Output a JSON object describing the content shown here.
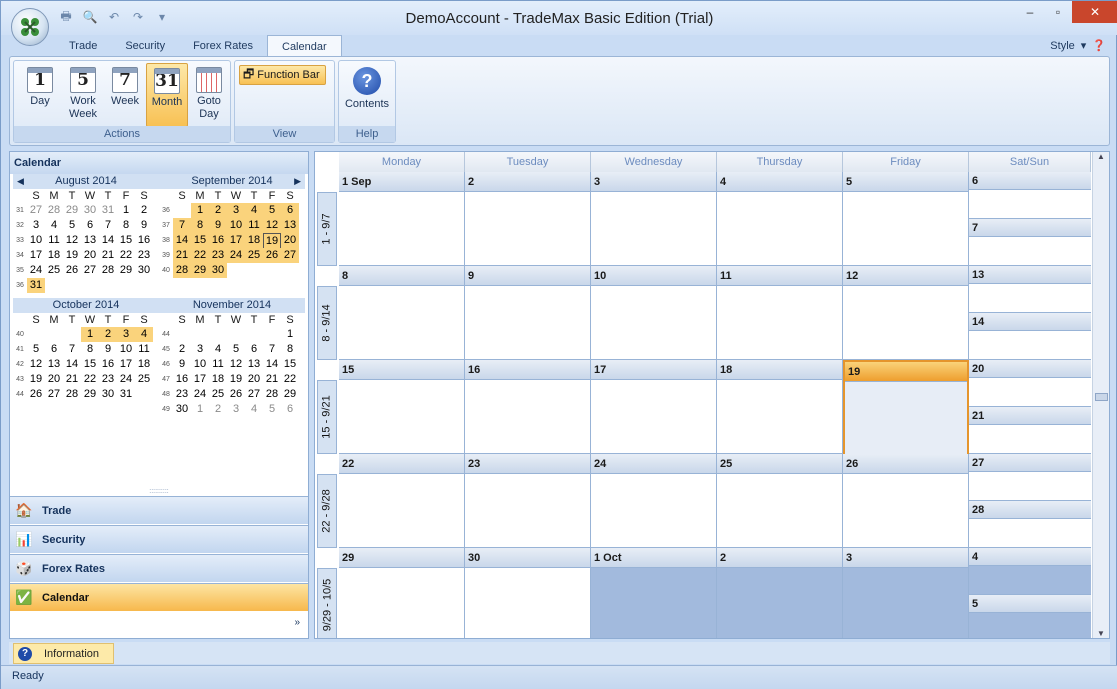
{
  "window": {
    "title": "DemoAccount - TradeMax Basic Edition (Trial)"
  },
  "qat": {
    "icons": [
      "printer-icon",
      "print-preview-icon",
      "undo-icon",
      "redo-icon",
      "customize-icon"
    ]
  },
  "tabs": [
    {
      "label": "Trade"
    },
    {
      "label": "Security"
    },
    {
      "label": "Forex Rates"
    },
    {
      "label": "Calendar"
    }
  ],
  "style_menu": {
    "label": "Style"
  },
  "ribbon": {
    "actions": {
      "label": "Actions",
      "buttons": [
        {
          "glyph": "1",
          "label_top": "Day",
          "label_bottom": ""
        },
        {
          "glyph": "5",
          "label_top": "Work",
          "label_bottom": "Week"
        },
        {
          "glyph": "7",
          "label_top": "Week",
          "label_bottom": ""
        },
        {
          "glyph": "31",
          "label_top": "Month",
          "label_bottom": ""
        },
        {
          "glyph": "",
          "label_top": "Goto",
          "label_bottom": "Day"
        }
      ]
    },
    "view": {
      "label": "View",
      "function_bar": "Function Bar"
    },
    "help": {
      "label": "Help",
      "contents": "Contents"
    }
  },
  "left_pane": {
    "title": "Calendar",
    "dow": [
      "S",
      "M",
      "T",
      "W",
      "T",
      "F",
      "S"
    ],
    "months": [
      {
        "name": "August 2014",
        "weeks": [
          {
            "wk": "31",
            "days": [
              [
                "27",
                "o"
              ],
              [
                "28",
                "o"
              ],
              [
                "29",
                "o"
              ],
              [
                "30",
                "o"
              ],
              [
                "31",
                "o"
              ],
              [
                "1",
                ""
              ],
              [
                "2",
                ""
              ]
            ]
          },
          {
            "wk": "32",
            "days": [
              [
                "3",
                ""
              ],
              [
                "4",
                ""
              ],
              [
                "5",
                ""
              ],
              [
                "6",
                ""
              ],
              [
                "7",
                ""
              ],
              [
                "8",
                ""
              ],
              [
                "9",
                ""
              ]
            ]
          },
          {
            "wk": "33",
            "days": [
              [
                "10",
                ""
              ],
              [
                "11",
                ""
              ],
              [
                "12",
                ""
              ],
              [
                "13",
                ""
              ],
              [
                "14",
                ""
              ],
              [
                "15",
                ""
              ],
              [
                "16",
                ""
              ]
            ]
          },
          {
            "wk": "34",
            "days": [
              [
                "17",
                ""
              ],
              [
                "18",
                ""
              ],
              [
                "19",
                ""
              ],
              [
                "20",
                ""
              ],
              [
                "21",
                ""
              ],
              [
                "22",
                ""
              ],
              [
                "23",
                ""
              ]
            ]
          },
          {
            "wk": "35",
            "days": [
              [
                "24",
                ""
              ],
              [
                "25",
                ""
              ],
              [
                "26",
                ""
              ],
              [
                "27",
                ""
              ],
              [
                "28",
                ""
              ],
              [
                "29",
                ""
              ],
              [
                "30",
                ""
              ]
            ]
          },
          {
            "wk": "36",
            "days": [
              [
                "31",
                "h"
              ],
              [
                "",
                ""
              ],
              [
                "",
                ""
              ],
              [
                "",
                ""
              ],
              [
                "",
                ""
              ],
              [
                "",
                ""
              ],
              [
                "",
                ""
              ]
            ]
          }
        ]
      },
      {
        "name": "September 2014",
        "weeks": [
          {
            "wk": "36",
            "days": [
              [
                "",
                ""
              ],
              [
                "1",
                "h"
              ],
              [
                "2",
                "h"
              ],
              [
                "3",
                "h"
              ],
              [
                "4",
                "h"
              ],
              [
                "5",
                "h"
              ],
              [
                "6",
                "h"
              ]
            ]
          },
          {
            "wk": "37",
            "days": [
              [
                "7",
                "h"
              ],
              [
                "8",
                "h"
              ],
              [
                "9",
                "h"
              ],
              [
                "10",
                "h"
              ],
              [
                "11",
                "h"
              ],
              [
                "12",
                "h"
              ],
              [
                "13",
                "h"
              ]
            ]
          },
          {
            "wk": "38",
            "days": [
              [
                "14",
                "h"
              ],
              [
                "15",
                "h"
              ],
              [
                "16",
                "h"
              ],
              [
                "17",
                "h"
              ],
              [
                "18",
                "h"
              ],
              [
                "19",
                "t"
              ],
              [
                "20",
                "h"
              ]
            ]
          },
          {
            "wk": "39",
            "days": [
              [
                "21",
                "h"
              ],
              [
                "22",
                "h"
              ],
              [
                "23",
                "h"
              ],
              [
                "24",
                "h"
              ],
              [
                "25",
                "h"
              ],
              [
                "26",
                "h"
              ],
              [
                "27",
                "h"
              ]
            ]
          },
          {
            "wk": "40",
            "days": [
              [
                "28",
                "h"
              ],
              [
                "29",
                "h"
              ],
              [
                "30",
                "h"
              ],
              [
                "",
                ""
              ],
              [
                "",
                ""
              ],
              [
                "",
                ""
              ],
              [
                "",
                ""
              ]
            ]
          }
        ]
      },
      {
        "name": "October 2014",
        "weeks": [
          {
            "wk": "40",
            "days": [
              [
                "",
                ""
              ],
              [
                "",
                ""
              ],
              [
                "",
                ""
              ],
              [
                "1",
                "h"
              ],
              [
                "2",
                "h"
              ],
              [
                "3",
                "h"
              ],
              [
                "4",
                "h"
              ]
            ]
          },
          {
            "wk": "41",
            "days": [
              [
                "5",
                ""
              ],
              [
                "6",
                ""
              ],
              [
                "7",
                ""
              ],
              [
                "8",
                ""
              ],
              [
                "9",
                ""
              ],
              [
                "10",
                ""
              ],
              [
                "11",
                ""
              ]
            ]
          },
          {
            "wk": "42",
            "days": [
              [
                "12",
                ""
              ],
              [
                "13",
                ""
              ],
              [
                "14",
                ""
              ],
              [
                "15",
                ""
              ],
              [
                "16",
                ""
              ],
              [
                "17",
                ""
              ],
              [
                "18",
                ""
              ]
            ]
          },
          {
            "wk": "43",
            "days": [
              [
                "19",
                ""
              ],
              [
                "20",
                ""
              ],
              [
                "21",
                ""
              ],
              [
                "22",
                ""
              ],
              [
                "23",
                ""
              ],
              [
                "24",
                ""
              ],
              [
                "25",
                ""
              ]
            ]
          },
          {
            "wk": "44",
            "days": [
              [
                "26",
                ""
              ],
              [
                "27",
                ""
              ],
              [
                "28",
                ""
              ],
              [
                "29",
                ""
              ],
              [
                "30",
                ""
              ],
              [
                "31",
                ""
              ],
              [
                "",
                ""
              ]
            ]
          }
        ]
      },
      {
        "name": "November 2014",
        "weeks": [
          {
            "wk": "44",
            "days": [
              [
                "",
                ""
              ],
              [
                "",
                ""
              ],
              [
                "",
                ""
              ],
              [
                "",
                ""
              ],
              [
                "",
                ""
              ],
              [
                "",
                ""
              ],
              [
                "1",
                ""
              ]
            ]
          },
          {
            "wk": "45",
            "days": [
              [
                "2",
                ""
              ],
              [
                "3",
                ""
              ],
              [
                "4",
                ""
              ],
              [
                "5",
                ""
              ],
              [
                "6",
                ""
              ],
              [
                "7",
                ""
              ],
              [
                "8",
                ""
              ]
            ]
          },
          {
            "wk": "46",
            "days": [
              [
                "9",
                ""
              ],
              [
                "10",
                ""
              ],
              [
                "11",
                ""
              ],
              [
                "12",
                ""
              ],
              [
                "13",
                ""
              ],
              [
                "14",
                ""
              ],
              [
                "15",
                ""
              ]
            ]
          },
          {
            "wk": "47",
            "days": [
              [
                "16",
                ""
              ],
              [
                "17",
                ""
              ],
              [
                "18",
                ""
              ],
              [
                "19",
                ""
              ],
              [
                "20",
                ""
              ],
              [
                "21",
                ""
              ],
              [
                "22",
                ""
              ]
            ]
          },
          {
            "wk": "48",
            "days": [
              [
                "23",
                ""
              ],
              [
                "24",
                ""
              ],
              [
                "25",
                ""
              ],
              [
                "26",
                ""
              ],
              [
                "27",
                ""
              ],
              [
                "28",
                ""
              ],
              [
                "29",
                ""
              ]
            ]
          },
          {
            "wk": "49",
            "days": [
              [
                "30",
                ""
              ],
              [
                "1",
                "o"
              ],
              [
                "2",
                "o"
              ],
              [
                "3",
                "o"
              ],
              [
                "4",
                "o"
              ],
              [
                "5",
                "o"
              ],
              [
                "6",
                "o"
              ]
            ]
          }
        ]
      }
    ],
    "nav": [
      {
        "label": "Trade",
        "icon": "house-icon"
      },
      {
        "label": "Security",
        "icon": "chart-icon"
      },
      {
        "label": "Forex Rates",
        "icon": "dice-icon"
      },
      {
        "label": "Calendar",
        "icon": "checklist-icon",
        "selected": true
      }
    ]
  },
  "calendar": {
    "day_headers": [
      "Monday",
      "Tuesday",
      "Wednesday",
      "Thursday",
      "Friday",
      "Sat/Sun"
    ],
    "weeks": [
      {
        "label": "1 - 9/7",
        "days": [
          "1 Sep",
          "2",
          "3",
          "4",
          "5"
        ],
        "sat": "6",
        "sun": "7",
        "other": []
      },
      {
        "label": "8 - 9/14",
        "days": [
          "8",
          "9",
          "10",
          "11",
          "12"
        ],
        "sat": "13",
        "sun": "14",
        "other": []
      },
      {
        "label": "15 - 9/21",
        "days": [
          "15",
          "16",
          "17",
          "18",
          "19"
        ],
        "sat": "20",
        "sun": "21",
        "other": [],
        "today": 4
      },
      {
        "label": "22 - 9/28",
        "days": [
          "22",
          "23",
          "24",
          "25",
          "26"
        ],
        "sat": "27",
        "sun": "28",
        "other": []
      },
      {
        "label": "9/29 - 10/5",
        "days": [
          "29",
          "30",
          "1 Oct",
          "2",
          "3"
        ],
        "sat": "4",
        "sun": "5",
        "other": [
          2,
          3,
          4,
          5,
          6
        ]
      }
    ]
  },
  "info": {
    "label": "Information"
  },
  "status": {
    "text": "Ready"
  },
  "colors": {
    "accent": "#f8c154",
    "frame": "#c9dcf4",
    "other_month": "#a2badd"
  }
}
